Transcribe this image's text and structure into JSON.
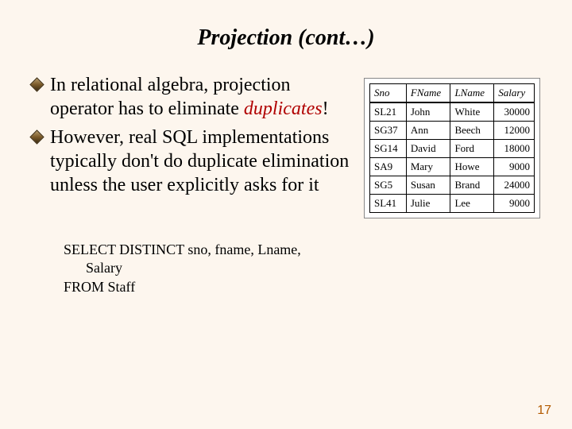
{
  "title": "Projection (cont…)",
  "bullets": {
    "item1_pre": "In relational algebra, projection operator has to eliminate ",
    "item1_emph": "duplicates",
    "item1_post": "!",
    "item2": "However, real SQL implementations typically don't do duplicate elimination unless the user explicitly asks for it"
  },
  "table": {
    "headers": {
      "c1": "Sno",
      "c2": "FName",
      "c3": "LName",
      "c4": "Salary"
    },
    "rows": [
      {
        "c1": "SL21",
        "c2": "John",
        "c3": "White",
        "c4": "30000"
      },
      {
        "c1": "SG37",
        "c2": "Ann",
        "c3": "Beech",
        "c4": "12000"
      },
      {
        "c1": "SG14",
        "c2": "David",
        "c3": "Ford",
        "c4": "18000"
      },
      {
        "c1": "SA9",
        "c2": "Mary",
        "c3": "Howe",
        "c4": "9000"
      },
      {
        "c1": "SG5",
        "c2": "Susan",
        "c3": "Brand",
        "c4": "24000"
      },
      {
        "c1": "SL41",
        "c2": "Julie",
        "c3": "Lee",
        "c4": "9000"
      }
    ]
  },
  "sql": {
    "line1": "SELECT DISTINCT sno, fname, Lname,",
    "line2": "Salary",
    "line3": "FROM Staff"
  },
  "page_number": "17"
}
